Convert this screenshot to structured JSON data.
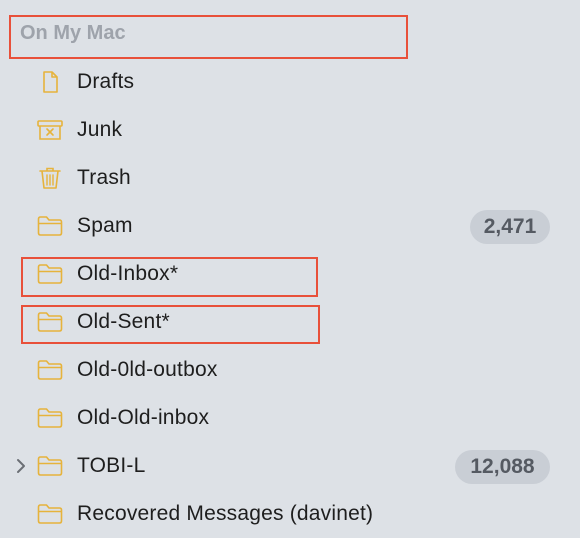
{
  "sidebar": {
    "section_title": "On My Mac",
    "items": [
      {
        "label": "Drafts",
        "icon": "document-icon"
      },
      {
        "label": "Junk",
        "icon": "junk-icon"
      },
      {
        "label": "Trash",
        "icon": "trash-icon"
      },
      {
        "label": "Spam",
        "icon": "folder-icon",
        "badge": "2,471"
      },
      {
        "label": "Old-Inbox*",
        "icon": "folder-icon"
      },
      {
        "label": "Old-Sent*",
        "icon": "folder-icon"
      },
      {
        "label": "Old-0ld-outbox",
        "icon": "folder-icon"
      },
      {
        "label": "Old-Old-inbox",
        "icon": "folder-icon"
      },
      {
        "label": "TOBI-L",
        "icon": "folder-icon",
        "badge": "12,088",
        "collapsed": true
      },
      {
        "label": "Recovered Messages (davinet)",
        "icon": "folder-icon"
      }
    ]
  },
  "colors": {
    "icon": "#e6b33c",
    "highlight": "#e8503a",
    "background": "#dde1e6"
  }
}
